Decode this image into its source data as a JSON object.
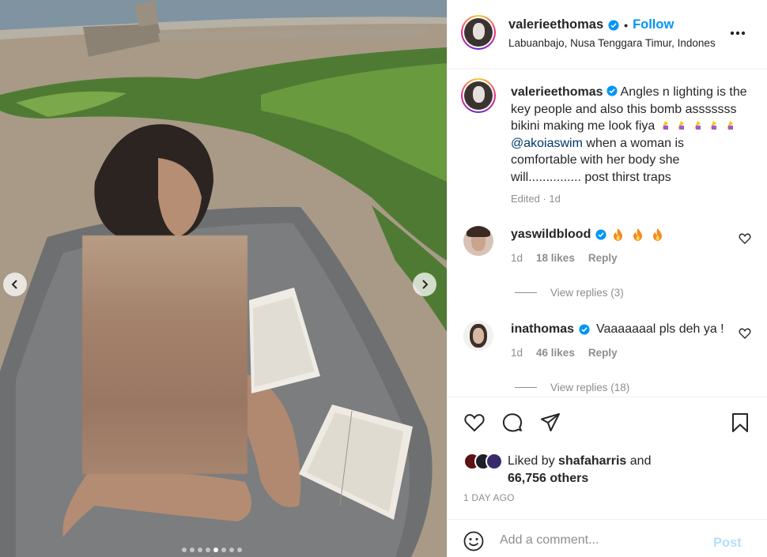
{
  "post": {
    "author": "valerieethomas",
    "follow_label": "Follow",
    "separator": "•",
    "location": "Labuanbajo, Nusa Tenggara Timur, Indonesia",
    "more_icon": "more-horizontal-icon"
  },
  "caption": {
    "username": "valerieethomas",
    "text_part1": "Angles n lighting is the key people and also this bomb asssssss bikini making me look fiya",
    "mention": "@akoiaswim",
    "text_part2": "when a woman is comfortable with her body she will............... post thirst traps",
    "edited": "Edited · 1d"
  },
  "comments": [
    {
      "username": "yaswildblood",
      "text": "",
      "emojis": "fire fire fire",
      "age": "1d",
      "likes": "18 likes",
      "reply_label": "Reply",
      "view_replies": "View replies (3)"
    },
    {
      "username": "inathomas",
      "text": "Vaaaaaaal pls deh ya !",
      "age": "1d",
      "likes": "46 likes",
      "reply_label": "Reply",
      "view_replies": "View replies (18)"
    }
  ],
  "engagement": {
    "liked_by_prefix": "Liked by",
    "liked_by_user": "shafaharris",
    "and": "and",
    "others": "66,756 others",
    "date": "1 DAY AGO"
  },
  "add_comment": {
    "placeholder": "Add a comment...",
    "post_label": "Post"
  },
  "carousel": {
    "slide_count": 8,
    "active_index": 4
  },
  "colors": {
    "accent": "#0095f6",
    "post_disabled": "#b2dffc",
    "muted": "#8e8e8e",
    "text": "#262626"
  }
}
